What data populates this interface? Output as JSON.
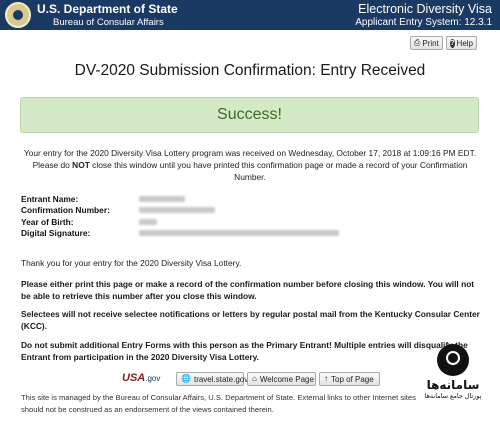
{
  "header": {
    "department": "U.S. Department of State",
    "bureau": "Bureau of Consular Affairs",
    "app_title": "Electronic Diversity Visa",
    "app_subtitle": "Applicant Entry System: 12.3.1"
  },
  "toolbar": {
    "print_label": "Print",
    "help_label": "Help"
  },
  "main": {
    "title": "DV-2020 Submission Confirmation: Entry Received",
    "success_label": "Success!",
    "intro_part1": "Your entry for the 2020 Diversity Visa Lottery program was received on Wednesday, October 17, 2018 at 1:09:16 PM EDT. Please do ",
    "intro_not": "NOT",
    "intro_part2": " close this window until you have printed this confirmation page or made a record of your Confirmation Number."
  },
  "fields": [
    {
      "label": "Entrant Name:"
    },
    {
      "label": "Confirmation Number:"
    },
    {
      "label": "Year of Birth:"
    },
    {
      "label": "Digital Signature:"
    }
  ],
  "messages": {
    "thanks": "Thank you for your entry for the 2020 Diversity Visa Lottery.",
    "print_warning": "Please either print this page or make a record of the confirmation number before closing this window. You will not be able to retrieve this number after you close this window.",
    "selectees": "Selectees will not receive selectee notifications or letters by regular postal mail from the Kentucky Consular Center (KCC).",
    "duplicate": "Do not submit additional Entry Forms with this person as the Primary Entrant! Multiple entries will disqualify the Entrant from participation in the 2020 Diversity Visa Lottery."
  },
  "links": {
    "usagov_logo": "USA",
    "usagov_suffix": ".gov",
    "travel": "travel.state.gov",
    "welcome": "Welcome Page",
    "top": "Top of Page"
  },
  "footer": {
    "text": "This site is managed by the Bureau of Consular Affairs, U.S. Department of State. External links to other Internet sites should not be construed as an endorsement of the views contained therein."
  },
  "watermark": {
    "name": "سامانه‌ها",
    "subtitle": "پورتال جامع سامانه‌ها"
  },
  "colors": {
    "header_bg": "#1b3a63",
    "success_bg": "#d5e9c6",
    "success_text": "#3b6a25"
  }
}
